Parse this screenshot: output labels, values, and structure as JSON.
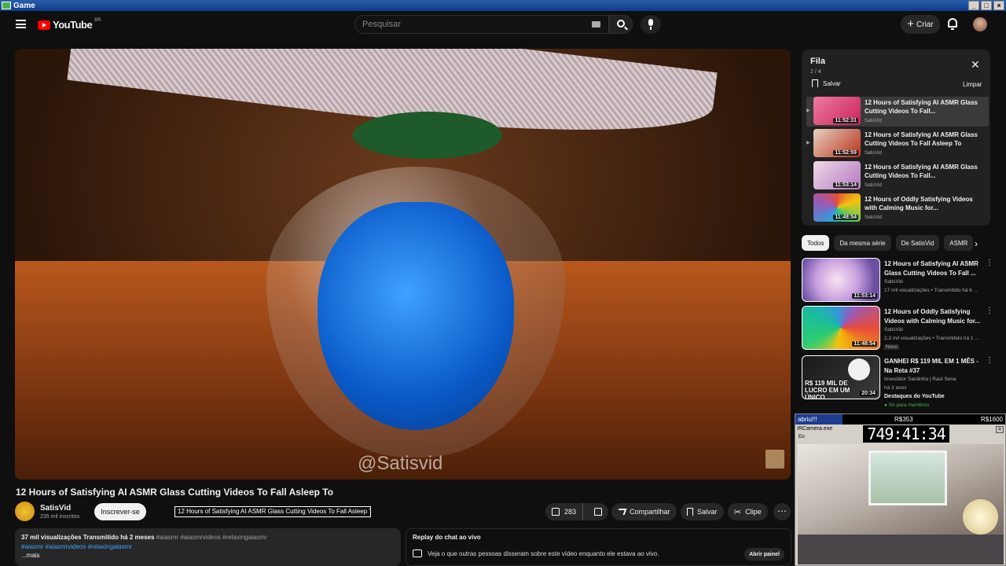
{
  "window": {
    "title": "Game"
  },
  "header": {
    "logo_text": "YouTube",
    "region": "BR",
    "search_placeholder": "Pesquisar",
    "create_label": "Criar"
  },
  "player": {
    "watermark": "@Satisvid"
  },
  "video": {
    "title": "12 Hours of Satisfying AI ASMR Glass Cutting Videos To Fall Asleep To",
    "tooltip": "12 Hours of Satisfying AI ASMR Glass Cutting Videos To Fall Asleep To",
    "channel": "SatisVid",
    "subscribers": "235 mil inscritos",
    "subscribe_label": "Inscrever-se",
    "likes": "283",
    "share_label": "Compartilhar",
    "save_label": "Salvar",
    "clip_label": "Clipe",
    "description": {
      "stats": "37 mil visualizações  Transmitido há 2 meses",
      "tags_inline": "#aiasmr #aiasmrvideos #relaxingaiasmr",
      "tags_links": "#aiasmr #aiasmrvideos #relaxingaiasmr",
      "more": "...mais"
    },
    "chat_replay": {
      "title": "Replay do chat ao vivo",
      "text": "Veja o que outras pessoas disseram sobre este vídeo enquanto ele estava ao vivo.",
      "open_label": "Abrir painel"
    }
  },
  "queue": {
    "title": "Fila",
    "count": "2 / 4",
    "save_label": "Salvar",
    "clear_label": "Limpar",
    "items": [
      {
        "title": "12 Hours of Satisfying AI ASMR Glass Cutting Videos To Fall...",
        "channel": "SatisVid",
        "duration": "11:52:31",
        "color": "#c7245a"
      },
      {
        "title": "12 Hours of Satisfying AI ASMR Glass Cutting Videos To Fall Asleep To",
        "channel": "SatisVid",
        "duration": "11:52:59",
        "color": "#b8321c"
      },
      {
        "title": "12 Hours of Satisfying AI ASMR Glass Cutting Videos To Fall...",
        "channel": "SatisVid",
        "duration": "11:53:14",
        "color": "#b27ac0"
      },
      {
        "title": "12 Hours of Oddly Satisfying Videos with Calming Music for...",
        "channel": "SatisVid",
        "duration": "11:48:54",
        "color": "#2fae7a"
      }
    ]
  },
  "chips": [
    "Todos",
    "Da mesma série",
    "De SatisVid",
    "ASMR"
  ],
  "recommendations": [
    {
      "title": "12 Hours of Satisfying AI ASMR Glass Cutting Videos To Fall ...",
      "channel": "SatisVid",
      "meta": "17 mil visualizações • Transmitido há 6 ...",
      "duration": "11:53:14",
      "color": "#8e72c8"
    },
    {
      "title": "12 Hours of Oddly Satisfying Videos with Calming Music for...",
      "channel": "SatisVid",
      "meta": "2,3 mil visualizações • Transmitido há 1 ...",
      "badge": "Novo",
      "duration": "11:48:54",
      "color": "#25a86f"
    },
    {
      "title": "GANHEI R$ 119 MIL EM 1 MÊS - Na Reta #37",
      "channel": "Investidor Sardinha | Raul Sena",
      "meta": "há 3 anos",
      "feature": "Destaques do YouTube",
      "members": "Só para membros",
      "duration": "20:34",
      "thumb_text": "R$ 119 MIL DE LUCRO EM UM ÚNICO",
      "color": "#2a2a2a"
    }
  ],
  "overlay": {
    "label": "abriu!!!",
    "mid": "R$353",
    "right": "R$1600",
    "timer": "749:41:34",
    "cam_title": "IRCamera.exe",
    "cam_sub": "Eic"
  }
}
